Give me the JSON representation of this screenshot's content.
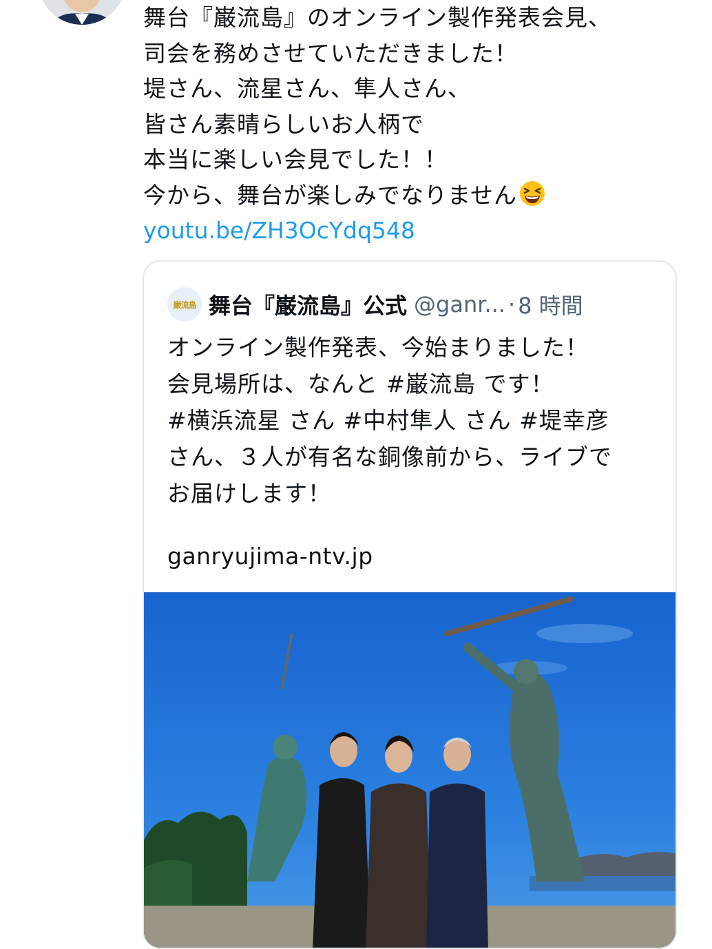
{
  "author_avatar": {
    "icon": "profile-photo-avatar"
  },
  "tweet": {
    "lines": [
      "舞台『巌流島』のオンライン製作発表会見、",
      "司会を務めさせていただきました！",
      "堤さん、流星さん、隼人さん、",
      "皆さん素晴らしいお人柄で",
      "本当に楽しい会見でした！！",
      "今から、舞台が楽しみでなりません"
    ],
    "emoji": "grinning-squinting-face-emoji",
    "link": "youtu.be/ZH3OcYdq548",
    "link_color": "#1d9bf0"
  },
  "quote": {
    "avatar_text": "巌流島",
    "name": "舞台『巌流島』公式",
    "handle": "@ganr...",
    "separator": "·",
    "time": "8 時間",
    "lines": [
      "オンライン製作発表、今始まりました！",
      "会見場所は、なんと #巌流島 です！",
      "#横浜流星 さん #中村隼人 さん #堤幸彦",
      "さん、３人が有名な銅像前から、ライブで",
      "お届けします！"
    ],
    "url": "ganryujima-ntv.jp",
    "image": {
      "icon": "photo-three-men-before-statue-ganryujima"
    }
  },
  "colors": {
    "text": "#0f1419",
    "secondary": "#536471",
    "border": "#e1e8ed",
    "sky": "#1b6fd6"
  }
}
